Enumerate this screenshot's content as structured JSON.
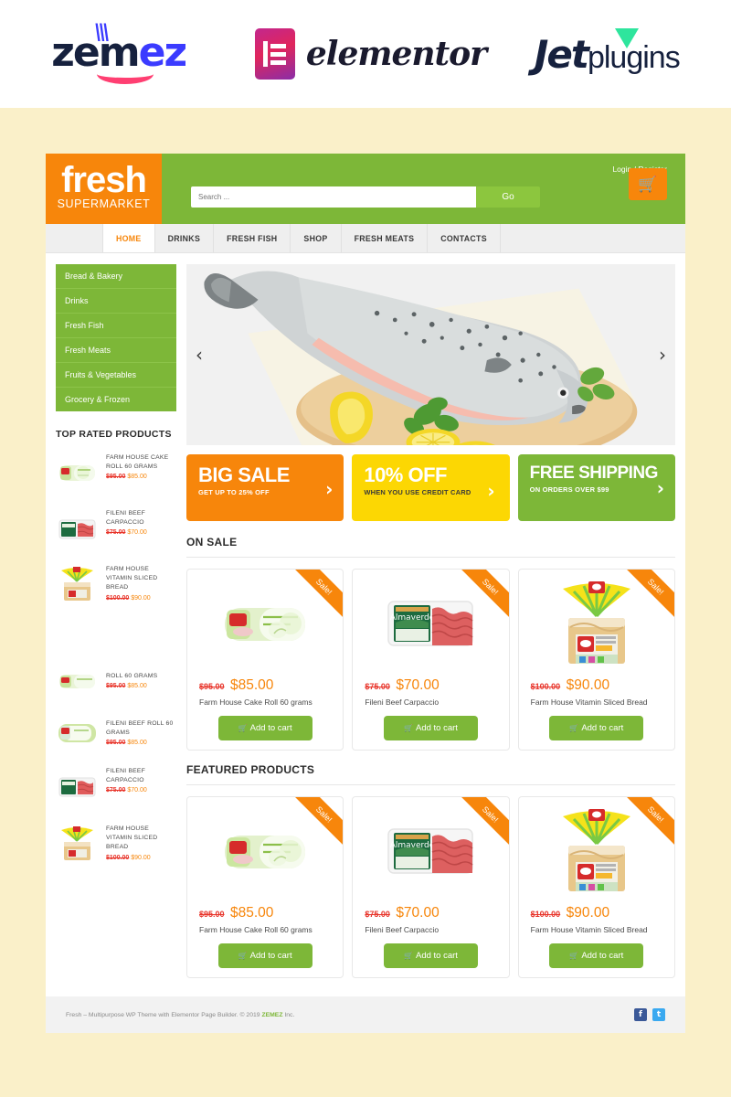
{
  "top_logos": [
    {
      "name": "zemez",
      "text": "zemez"
    },
    {
      "name": "elementor",
      "text": "elementor"
    },
    {
      "name": "jetplugins",
      "text_bold": "Jet",
      "text_light": "plugins"
    }
  ],
  "site": {
    "brand": {
      "main": "fresh",
      "sub": "SUPERMARKET"
    },
    "header": {
      "login_register": "Login / Register",
      "search_placeholder": "Search ...",
      "search_value": "",
      "go_label": "Go",
      "cart_icon": "shopping-cart-icon"
    },
    "nav": [
      {
        "label": "HOME",
        "active": true
      },
      {
        "label": "DRINKS",
        "active": false
      },
      {
        "label": "FRESH FISH",
        "active": false
      },
      {
        "label": "SHOP",
        "active": false
      },
      {
        "label": "FRESH MEATS",
        "active": false
      },
      {
        "label": "CONTACTS",
        "active": false
      }
    ],
    "sidebar": {
      "categories": [
        "Bread & Bakery",
        "Drinks",
        "Fresh Fish",
        "Fresh Meats",
        "Fruits & Vegetables",
        "Grocery & Frozen"
      ],
      "top_rated_title": "TOP RATED PRODUCTS",
      "top_rated": [
        {
          "name": "FARM HOUSE CAKE ROLL 60 GRAMS",
          "old_price": "$95.00",
          "new_price": "$85.00",
          "thumb": "cake-roll"
        },
        {
          "name": "FILENI BEEF CARPACCIO",
          "old_price": "$75.00",
          "new_price": "$70.00",
          "thumb": "beef-tray"
        },
        {
          "name": "FARM HOUSE VITAMIN SLICED BREAD",
          "old_price": "$100.00",
          "new_price": "$90.00",
          "thumb": "sliced-bread"
        },
        {
          "name": "ROLL 60 GRAMS",
          "old_price": "$95.00",
          "new_price": "$85.00",
          "thumb": "cake-roll"
        },
        {
          "name": "FILENI BEEF ROLL 60 GRAMS",
          "old_price": "$95.00",
          "new_price": "$85.00",
          "thumb": "cake-roll"
        },
        {
          "name": "FILENI BEEF CARPACCIO",
          "old_price": "$75.00",
          "new_price": "$70.00",
          "thumb": "beef-tray"
        },
        {
          "name": "FARM HOUSE VITAMIN SLICED BREAD",
          "old_price": "$100.00",
          "new_price": "$90.00",
          "thumb": "sliced-bread"
        }
      ]
    },
    "slider": {
      "image_alt": "Whole raw salmon fish on wooden cutting board with lemon slices and herbs",
      "prev_icon": "chevron-left-icon",
      "next_icon": "chevron-right-icon"
    },
    "promos": [
      {
        "title": "BIG SALE",
        "subtitle": "GET UP TO 25% OFF",
        "color": "#f7860b",
        "arrow_icon": "chevron-right-icon"
      },
      {
        "title": "10% OFF",
        "subtitle": "WHEN YOU USE CREDIT CARD",
        "color": "#fcd703",
        "arrow_icon": "chevron-right-icon"
      },
      {
        "title": "FREE SHIPPING",
        "subtitle": "ON ORDERS OVER $99",
        "color": "#7db738",
        "arrow_icon": "chevron-right-icon"
      }
    ],
    "sections": [
      {
        "heading": "ON SALE",
        "products": [
          {
            "badge": "Sale!",
            "old_price": "$95.00",
            "new_price": "$85.00",
            "name": "Farm House Cake Roll 60 grams",
            "cta": "Add to cart",
            "image": "cake-roll"
          },
          {
            "badge": "Sale!",
            "old_price": "$75.00",
            "new_price": "$70.00",
            "name": "Fileni Beef Carpaccio",
            "cta": "Add to cart",
            "image": "beef-tray"
          },
          {
            "badge": "Sale!",
            "old_price": "$100.00",
            "new_price": "$90.00",
            "name": "Farm House Vitamin Sliced Bread",
            "cta": "Add to cart",
            "image": "sliced-bread"
          }
        ]
      },
      {
        "heading": "FEATURED PRODUCTS",
        "products": [
          {
            "badge": "Sale!",
            "old_price": "$95.00",
            "new_price": "$85.00",
            "name": "Farm House Cake Roll 60 grams",
            "cta": "Add to cart",
            "image": "cake-roll"
          },
          {
            "badge": "Sale!",
            "old_price": "$75.00",
            "new_price": "$70.00",
            "name": "Fileni Beef Carpaccio",
            "cta": "Add to cart",
            "image": "beef-tray"
          },
          {
            "badge": "Sale!",
            "old_price": "$100.00",
            "new_price": "$90.00",
            "name": "Farm House Vitamin Sliced Bread",
            "cta": "Add to cart",
            "image": "sliced-bread"
          }
        ]
      }
    ],
    "footer": {
      "text_before": "Fresh – Multipurpose WP Theme with Elementor Page Builder. © 2019 ",
      "brand": "ZEMEZ",
      "text_after": " Inc.",
      "socials": [
        {
          "name": "facebook-icon",
          "glyph": "f",
          "color": "#3b5998"
        },
        {
          "name": "twitter-icon",
          "glyph": "t",
          "color": "#3aa9f0"
        }
      ]
    }
  },
  "colors": {
    "page_bg": "#faf0c9",
    "green": "#7db738",
    "orange": "#f7860b",
    "yellow": "#fcd703",
    "sale_red": "#e8352b"
  }
}
